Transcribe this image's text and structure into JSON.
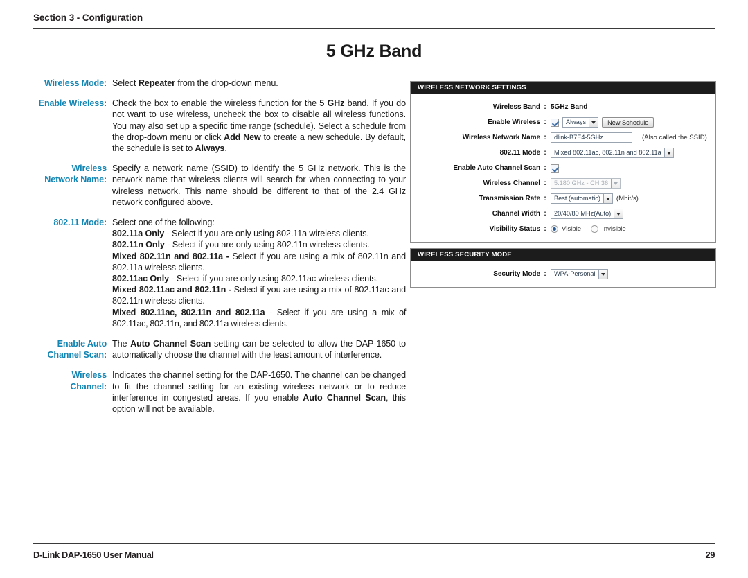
{
  "header": {
    "section_title": "Section 3 - Configuration"
  },
  "page_title": "5 GHz Band",
  "definitions": [
    {
      "label": "Wireless Mode:",
      "paragraphs": [
        [
          {
            "t": "Select "
          },
          {
            "t": "Repeater",
            "b": true
          },
          {
            "t": " from the drop-down menu."
          }
        ]
      ]
    },
    {
      "label": "Enable Wireless:",
      "paragraphs": [
        [
          {
            "t": "Check the box to enable the wireless function for the "
          },
          {
            "t": "5 GHz",
            "b": true
          },
          {
            "t": " band. If you do not want to use wireless, uncheck the box to disable all wireless functions. You may also set up a specific time range (schedule). Select a schedule from the drop-down menu or click "
          },
          {
            "t": "Add New",
            "b": true
          },
          {
            "t": " to create a new schedule. By default, the schedule is set to "
          },
          {
            "t": "Always",
            "b": true
          },
          {
            "t": "."
          }
        ]
      ]
    },
    {
      "label": "Wireless\nNetwork Name:",
      "paragraphs": [
        [
          {
            "t": "Specify a network name (SSID) to identify the 5 GHz network. This is the network name that wireless clients will search for when connecting to your wireless network. This name should be different to that of the 2.4 GHz network configured above."
          }
        ]
      ]
    },
    {
      "label": "802.11 Mode:",
      "paragraphs": [
        [
          {
            "t": "Select one of the following:"
          }
        ],
        [
          {
            "t": "802.11a Only",
            "b": true
          },
          {
            "t": " - Select if you are only using 802.11a wireless clients."
          }
        ],
        [
          {
            "t": "802.11n Only",
            "b": true
          },
          {
            "t": " - Select if you are only using 802.11n wireless clients."
          }
        ],
        [
          {
            "t": "Mixed 802.11n and 802.11a -",
            "b": true
          },
          {
            "t": " Select if you are using a mix of 802.11n and 802.11a wireless clients."
          }
        ],
        [
          {
            "t": "802.11ac Only",
            "b": true
          },
          {
            "t": " - Select if you are only using 802.11ac wireless clients."
          }
        ],
        [
          {
            "t": "Mixed 802.11ac and 802.11n -",
            "b": true
          },
          {
            "t": " Select if you are using a mix of 802.11ac and 802.11n wireless clients."
          }
        ],
        [
          {
            "t": "Mixed 802.11ac, 802.11n and 802.11a",
            "b": true
          },
          {
            "t": " - Select if you are using a mix of 802.11ac, 802.11n, and 802.11a wireless clients."
          }
        ]
      ]
    },
    {
      "label": "Enable Auto\nChannel Scan:",
      "paragraphs": [
        [
          {
            "t": "The "
          },
          {
            "t": "Auto Channel Scan",
            "b": true
          },
          {
            "t": " setting can be selected to allow the DAP-1650 to automatically choose the channel with the least amount of interference."
          }
        ]
      ]
    },
    {
      "label": "Wireless\nChannel:",
      "paragraphs": [
        [
          {
            "t": "Indicates the channel setting for the DAP-1650.  The channel can be changed to fit the channel setting for an existing wireless network or to reduce interference in congested areas. If you enable "
          },
          {
            "t": "Auto Channel Scan",
            "b": true
          },
          {
            "t": ", this option will not be available."
          }
        ]
      ]
    }
  ],
  "panel": {
    "network_settings": {
      "title": "WIRELESS NETWORK SETTINGS",
      "fields": [
        {
          "label": "Wireless Band",
          "type": "static",
          "value": "5GHz Band"
        },
        {
          "label": "Enable Wireless",
          "type": "checkbox-schedule",
          "checked": true,
          "schedule_value": "Always",
          "button_label": "New Schedule"
        },
        {
          "label": "Wireless Network Name",
          "type": "textbox",
          "value": "dlink-B7E4-5GHz",
          "note": "(Also called the SSID)"
        },
        {
          "label": "802.11 Mode",
          "type": "select",
          "value": "Mixed 802.11ac, 802.11n and 802.11a"
        },
        {
          "label": "Enable Auto Channel Scan",
          "type": "checkbox",
          "checked": true
        },
        {
          "label": "Wireless Channel",
          "type": "select-disabled",
          "value": "5.180 GHz - CH 36"
        },
        {
          "label": "Transmission Rate",
          "type": "select",
          "value": "Best (automatic)",
          "note": "(Mbit/s)"
        },
        {
          "label": "Channel Width",
          "type": "select",
          "value": "20/40/80 MHz(Auto)"
        },
        {
          "label": "Visibility Status",
          "type": "radio",
          "options": [
            "Visible",
            "Invisible"
          ],
          "selected": "Visible"
        }
      ]
    },
    "security_mode": {
      "title": "WIRELESS SECURITY MODE",
      "fields": [
        {
          "label": "Security Mode",
          "type": "select",
          "value": "WPA-Personal"
        }
      ]
    }
  },
  "footer": {
    "manual_title": "D-Link DAP-1650 User Manual",
    "page_number": "29"
  },
  "colors": {
    "label_accent": "#1386b4",
    "card_header_bg": "#1c1c1c",
    "text": "#1a1a1a"
  }
}
